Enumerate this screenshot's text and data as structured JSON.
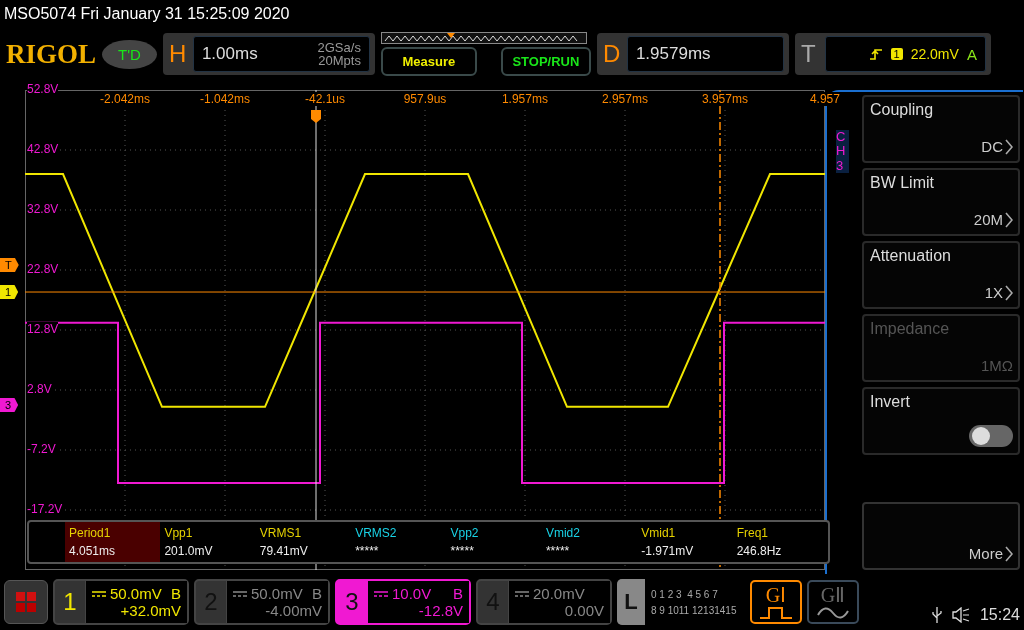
{
  "header": {
    "title": "MSO5074  Fri January 31 15:25:09 2020"
  },
  "logo": "RIGOL",
  "td_badge": "T'D",
  "horizontal": {
    "letter": "H",
    "timebase": "1.00ms",
    "sample_rate": "2GSa/s",
    "memory_depth": "20Mpts"
  },
  "buttons": [
    {
      "label": "Measure",
      "kind": "measure"
    },
    {
      "label": "STOP/RUN",
      "kind": "run"
    }
  ],
  "delay": {
    "letter": "D",
    "value": "1.9579ms"
  },
  "trigger": {
    "letter": "T",
    "source": "1",
    "level": "22.0mV",
    "mode": "A"
  },
  "plot": {
    "chart_data": {
      "type": "line",
      "xlim": [
        -3.042,
        4.958
      ],
      "ylim": [
        -27.2,
        52.8
      ],
      "x": [
        -3.042,
        -2.662,
        -2.112,
        -2.112,
        -1.672,
        -0.642,
        -0.092,
        -0.092,
        0.358,
        1.388,
        1.928,
        1.928,
        2.378,
        3.388,
        3.948,
        3.948,
        4.408,
        4.958
      ],
      "series": [
        {
          "color": "#f0e600",
          "values": [
            38.8,
            38.8,
            17.2,
            17.2,
            0,
            0,
            21.3,
            21.3,
            38.8,
            38.8,
            17.6,
            17.6,
            0,
            0,
            21.3,
            21.3,
            38.8,
            38.8
          ]
        },
        {
          "color": "#f019d2",
          "values": [
            14,
            14,
            14,
            -12.7,
            -12.7,
            -12.7,
            -12.7,
            14,
            14,
            14,
            14,
            -12.7,
            -12.7,
            -12.7,
            -12.7,
            14,
            14,
            14
          ]
        }
      ],
      "xticks": [
        {
          "value": -2.042,
          "label": "-2.042ms"
        },
        {
          "value": -1.042,
          "label": "-1.042ms"
        },
        {
          "value": 1.957,
          "label": "1.957ms"
        },
        {
          "value": 2.957,
          "label": "2.957ms"
        },
        {
          "value": 3.957,
          "label": "3.957ms"
        },
        {
          "value": 4.957,
          "label": "4.957"
        }
      ],
      "grid": true,
      "ref_lines": [
        {
          "axis": "y",
          "value": 19.13,
          "color": "#ff8a00"
        },
        {
          "axis": "x",
          "value": -0.132,
          "color": "#dddddd"
        },
        {
          "axis": "x",
          "value": 3.908,
          "color": "#ff8a00"
        }
      ],
      "yticks": [
        {
          "value": 52.8,
          "label": "52.8V"
        },
        {
          "value": 42.8,
          "label": "42.8V"
        },
        {
          "value": 32.8,
          "label": "32.8V"
        },
        {
          "value": 22.8,
          "label": "22.8V"
        },
        {
          "value": 12.8,
          "label": "12.8V"
        },
        {
          "value": 2.8,
          "label": "2.8V"
        },
        {
          "value": -7.2,
          "label": "-7.2V"
        },
        {
          "value": -17.2,
          "label": "-17.2V"
        }
      ]
    },
    "us_labels": [
      "-42.1us",
      "957.9us"
    ],
    "markers": [
      {
        "label": "T",
        "kind": "trigger"
      },
      {
        "label": "1",
        "kind": "ch1"
      },
      {
        "label": "3",
        "kind": "ch3"
      }
    ]
  },
  "measurements": [
    {
      "name": "Period1",
      "value": "4.051ms",
      "color": "#e6d200",
      "selected": true
    },
    {
      "name": "Vpp1",
      "value": "201.0mV",
      "color": "#e6d200",
      "selected": false
    },
    {
      "name": "VRMS1",
      "value": "79.41mV",
      "color": "#e6d200",
      "selected": false
    },
    {
      "name": "VRMS2",
      "value": "*****",
      "color": "#19d2e6",
      "selected": false
    },
    {
      "name": "Vpp2",
      "value": "*****",
      "color": "#19d2e6",
      "selected": false
    },
    {
      "name": "Vmid2",
      "value": "*****",
      "color": "#19d2e6",
      "selected": false
    },
    {
      "name": "Vmid1",
      "value": "-1.971mV",
      "color": "#e6d200",
      "selected": false
    },
    {
      "name": "Freq1",
      "value": "246.8Hz",
      "color": "#e6d200",
      "selected": false
    }
  ],
  "side_menu": {
    "tab": "CH3",
    "items": [
      {
        "kind": "option",
        "label": "Coupling",
        "value": "DC",
        "disabled": false
      },
      {
        "kind": "option",
        "label": "BW Limit",
        "value": "20M",
        "disabled": false
      },
      {
        "kind": "option",
        "label": "Attenuation",
        "value": "1X",
        "disabled": false
      },
      {
        "kind": "readonly",
        "label": "Impedance",
        "value": "1MΩ",
        "disabled": true
      },
      {
        "kind": "toggle",
        "label": "Invert",
        "on": false,
        "disabled": false
      },
      {
        "kind": "more",
        "value": "More",
        "disabled": false
      }
    ]
  },
  "channels": [
    {
      "number": "1",
      "scale": "50.0mV",
      "bw": "B",
      "offset": "+32.0mV",
      "enabled": true,
      "selected": false,
      "color": "#f0e600"
    },
    {
      "number": "2",
      "scale": "50.0mV",
      "bw": "B",
      "offset": "-4.00mV",
      "enabled": false,
      "selected": false
    },
    {
      "number": "3",
      "scale": "10.0V",
      "bw": "B",
      "offset": "-12.8V",
      "enabled": true,
      "selected": true,
      "color": "#f019d2"
    },
    {
      "number": "4",
      "scale": "20.0mV",
      "offset": "0.00V",
      "enabled": false,
      "selected": false
    }
  ],
  "logic": {
    "letter": "L",
    "row_1": "0 1 2 3  4 5 6 7",
    "row_2": "8 9 1011 12131415"
  },
  "generators": [
    {
      "label": "GⅠ",
      "kind": "square",
      "active": true
    },
    {
      "label": "GⅡ",
      "kind": "sine",
      "active": false
    }
  ],
  "status_bar": {
    "time": "15:24"
  }
}
